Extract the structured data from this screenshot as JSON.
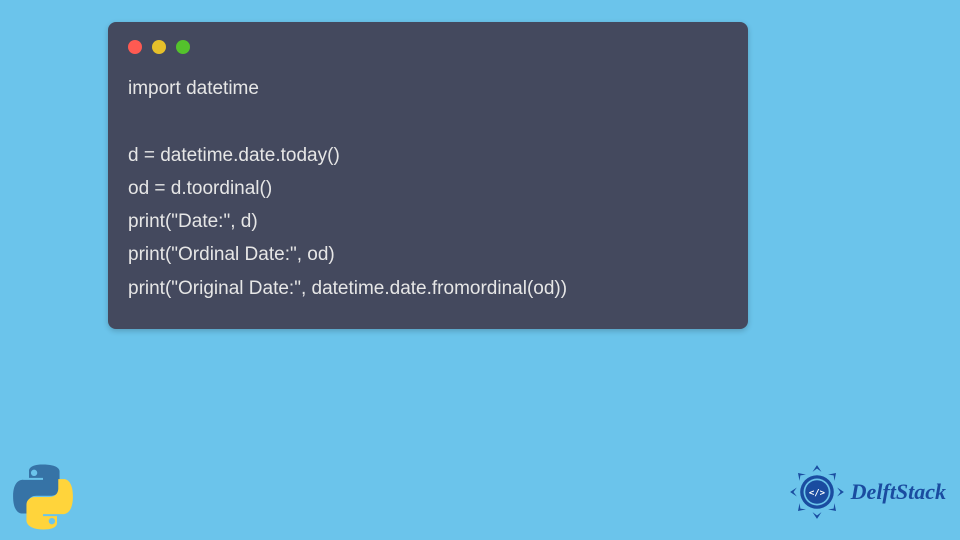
{
  "code": {
    "lines": [
      "import datetime",
      "",
      "d = datetime.date.today()",
      "od = d.toordinal()",
      "print(\"Date:\", d)",
      "print(\"Ordinal Date:\", od)",
      "print(\"Original Date:\", datetime.date.fromordinal(od))"
    ]
  },
  "branding": {
    "name": "DelftStack"
  }
}
